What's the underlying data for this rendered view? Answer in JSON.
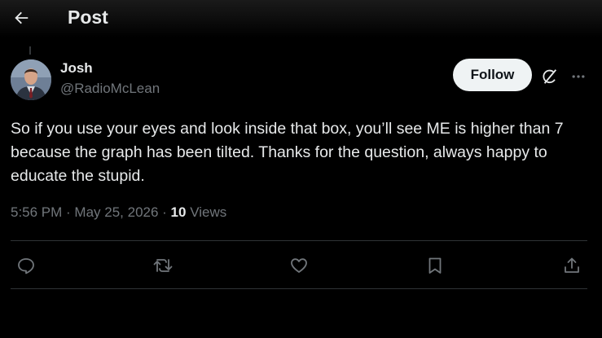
{
  "header": {
    "title": "Post"
  },
  "author": {
    "name": "Josh",
    "handle": "@RadioMcLean"
  },
  "follow_label": "Follow",
  "post": {
    "text": "So if you use your eyes and look inside that box, you’ll see ME is higher than 7 because the graph has been tilted. Thanks for the question, always happy to educate the stupid."
  },
  "meta": {
    "time": "5:56 PM",
    "sep1": " · ",
    "date": "May 25, 2026",
    "sep2": " · ",
    "views_count": "10",
    "views_label": " Views"
  },
  "icons": {
    "back": "arrow-left-icon",
    "grok": "grok-icon",
    "more": "more-dots-icon",
    "reply": "reply-icon",
    "repost": "repost-icon",
    "like": "like-icon",
    "bookmark": "bookmark-icon",
    "share": "share-icon"
  },
  "colors": {
    "background": "#000000",
    "text": "#e7e9ea",
    "muted": "#71767b",
    "divider": "#2f3336",
    "follow_bg": "#eff3f4"
  }
}
